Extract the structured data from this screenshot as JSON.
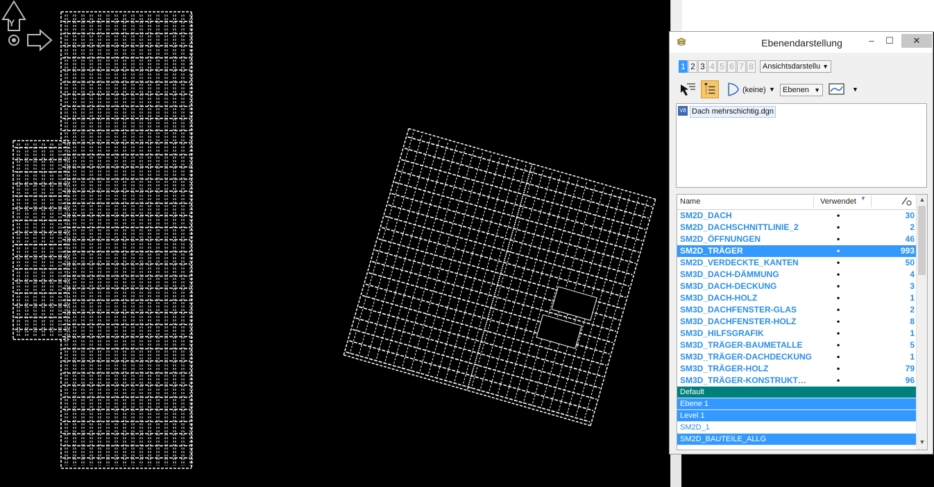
{
  "dialog": {
    "title": "Ebenendarstellung",
    "close_glyph": "✕",
    "min_glyph": "‒",
    "max_glyph": "☐"
  },
  "view_tabs": [
    "1",
    "2",
    "3",
    "4",
    "5",
    "6",
    "7",
    "8"
  ],
  "view_dropdown": "Ansichtsdarstellu",
  "toolbar": {
    "filter_label": "(keine)",
    "levels_dropdown": "Ebenen"
  },
  "file": {
    "icon": "V8",
    "name": "Dach mehrschichtig.dgn"
  },
  "table": {
    "col_name": "Name",
    "col_used": "Verwendet",
    "rows": [
      {
        "name": "SM2D_DACH",
        "used": "•",
        "count": "30"
      },
      {
        "name": "SM2D_DACHSCHNITTLINIE_2",
        "used": "•",
        "count": "2"
      },
      {
        "name": "SM2D_ÖFFNUNGEN",
        "used": "•",
        "count": "46"
      },
      {
        "name": "SM2D_TRÄGER",
        "used": "•",
        "count": "993"
      },
      {
        "name": "SM2D_VERDECKTE_KANTEN",
        "used": "•",
        "count": "50"
      },
      {
        "name": "SM3D_DACH-DÄMMUNG",
        "used": "•",
        "count": "4"
      },
      {
        "name": "SM3D_DACH-DECKUNG",
        "used": "•",
        "count": "3"
      },
      {
        "name": "SM3D_DACH-HOLZ",
        "used": "•",
        "count": "1"
      },
      {
        "name": "SM3D_DACHFENSTER-GLAS",
        "used": "•",
        "count": "2"
      },
      {
        "name": "SM3D_DACHFENSTER-HOLZ",
        "used": "•",
        "count": "8"
      },
      {
        "name": "SM3D_HILFSGRAFIK",
        "used": "•",
        "count": "1"
      },
      {
        "name": "SM3D_TRÄGER-BAUMETALLE",
        "used": "•",
        "count": "5"
      },
      {
        "name": "SM3D_TRÄGER-DACHDECKUNG",
        "used": "•",
        "count": "1"
      },
      {
        "name": "SM3D_TRÄGER-HOLZ",
        "used": "•",
        "count": "79"
      },
      {
        "name": "SM3D_TRÄGER-KONSTRUKT…",
        "used": "•",
        "count": "96"
      }
    ],
    "unused_rows": [
      "Default",
      "Ebene 1",
      "Level 1",
      "SM2D_1",
      "SM2D_BAUTEILE_ALLG"
    ]
  },
  "axis": {
    "y_label": "Y"
  },
  "colors": {
    "selection": "#3399ff",
    "level_text": "#2a8ee8",
    "teal": "#00807c"
  }
}
